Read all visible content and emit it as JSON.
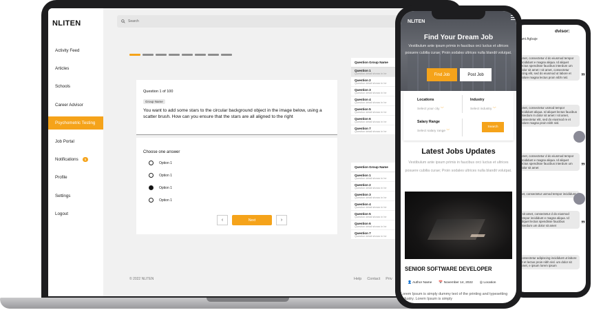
{
  "laptop": {
    "brand": "NLITEN",
    "search_placeholder": "Search",
    "nav": [
      "Activity Feed",
      "Articles",
      "Schools",
      "Career Advisor",
      "Psychometric Testing",
      "Job Portal",
      "Notifications",
      "Profile",
      "Settings",
      "Logout"
    ],
    "active_nav": "Psychometric Testing",
    "notifications_badge": "5",
    "progress": {
      "total_segments": 8,
      "completed": 1
    },
    "question": {
      "counter": "Question 1 of 100",
      "group_tag": "Group Name",
      "text": "You want to add some stars to the circular background object in the image below, using a scatter brush. How can you ensure that the stars are all aligned to the right"
    },
    "answer": {
      "prompt": "Choose one answer",
      "options": [
        "Option 1",
        "Option 1",
        "Option 1",
        "Option 1"
      ],
      "selected_index": 2
    },
    "pager": {
      "prev": "‹",
      "next_label": "Next",
      "next_arrow": "›"
    },
    "groups": [
      {
        "heading": "Question Group Name",
        "items": [
          {
            "title": "Question 1",
            "detail": "Question detail shows in he"
          },
          {
            "title": "Question 2",
            "detail": "Question detail shows in he"
          },
          {
            "title": "Question 3",
            "detail": "Question detail shows in he"
          },
          {
            "title": "Question 4",
            "detail": "Question detail shows in he"
          },
          {
            "title": "Question 5",
            "detail": "Question detail shows in he"
          },
          {
            "title": "Question 6",
            "detail": "Question detail shows in he"
          },
          {
            "title": "Question 7",
            "detail": "Question detail shows in he"
          }
        ]
      },
      {
        "heading": "Question Group Name",
        "items": [
          {
            "title": "Question 1",
            "detail": "Question detail shows in he"
          },
          {
            "title": "Question 2",
            "detail": "Question detail shows in he"
          },
          {
            "title": "Question 3",
            "detail": "Question detail shows in he"
          },
          {
            "title": "Question 4",
            "detail": "Question detail shows in he"
          },
          {
            "title": "Question 5",
            "detail": "Question detail shows in he"
          },
          {
            "title": "Question 6",
            "detail": "Question detail shows in he"
          },
          {
            "title": "Question 7",
            "detail": "Question detail shows in he"
          }
        ]
      }
    ],
    "footer": {
      "copyright": "© 2022 NLITEN",
      "links": [
        "Help",
        "Contact",
        "Priv"
      ]
    }
  },
  "phone_front": {
    "brand": "NLITEN",
    "hero_title": "Find Your Dream Job",
    "hero_text": "Vestibulum ante ipsum primis in faucibus orci luctus et ultrices posuere cubilia curae; Proin sodales ultrices nulla blandit volutpat.",
    "find_job": "Find Job",
    "post_job": "Post Job",
    "locations_label": "Locations",
    "locations_value": "Select your city",
    "industry_label": "Industry",
    "industry_value": "Select industry",
    "salary_label": "Salary Range",
    "salary_value": "Select salary range",
    "search_button": "Search",
    "latest_title": "Latest Jobs Updates",
    "latest_text": "Vestibulum ante ipsum primis in faucibus orci luctus et ultrices posuere cubilia curae; Proin sodales ultrices nulla blandit volutpat.",
    "job_title": "SENIOR SOFTWARE DEVELOPER",
    "author": "Author Name",
    "date": "November 14, 2022",
    "location": "Location",
    "job_desc": "Lorem Ipsum is simply dummy text of the printing and typesetting industry. Lorem Ipsum is simply"
  },
  "phone_back": {
    "title": "dvisor:",
    "subtitle": "ami Agbaje",
    "bubbles": [
      "amet, consectetur d do eiusmod tempor incididunt e magna aliqua. Id aliquet lectus spendisse faucibus interdum um dolor sit amet r sit amet, consectetur scing elit, sed do eiusmod ut labore et dolore magna lectus proin nibh nisl.",
      "amet, consectetur d do eiusmod tempor incididunt e magna aliqua. Id aliquet lectus spendisse faucibus interdum um dolor sit amet",
      "amet, consectetur usmod tempor incididunt aliqua. Id aliquet lectus faucibus interdum m dolor sit amet r sit amet, consectetur elit, sed do eiusmod re et dolore magna proin nibh nisl.",
      "r sit amet, consectetur d do eiusmod tempor incididunt e magna aliqua. Id aliquet lectus spendisse faucibus interdum um dolor sit amet",
      "net, consectetur usmod tempor incididunt",
      "r sit amet, consectetur d do eiusmod tempor incididunt e magna aliqua. Id aliquet lectus spendisse faucibus interdum um dolor sit amet",
      "consectetur adipiscing incididunt ut labore et et lectus proin nibh nisl. um dolor sit amet, e ipsum lorem ipsum"
    ]
  },
  "colors": {
    "accent": "#f5a31a",
    "device": "#1d1d1f"
  }
}
